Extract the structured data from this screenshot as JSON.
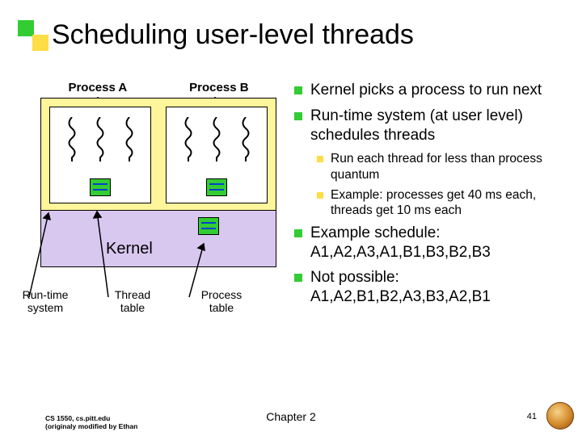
{
  "title": "Scheduling user-level threads",
  "diagram": {
    "process_a_label": "Process A",
    "process_b_label": "Process B",
    "kernel_label": "Kernel",
    "runtime_system_label": "Run-time\nsystem",
    "thread_table_label": "Thread\ntable",
    "process_table_label": "Process\ntable"
  },
  "bullets": {
    "b1": "Kernel picks a process to run next",
    "b2": "Run-time system (at user level) schedules threads",
    "b2a": "Run each thread for less than process quantum",
    "b2b": "Example: processes get 40 ms each, threads get 10 ms each",
    "b3": "Example schedule: A1,A2,A3,A1,B1,B3,B2,B3",
    "b4": "Not possible: A1,A2,B1,B2,A3,B3,A2,B1"
  },
  "footer": {
    "left_line1": "CS 1550, cs.pitt.edu",
    "left_line2": "(originaly modified by Ethan",
    "center": "Chapter 2",
    "page": "41"
  }
}
